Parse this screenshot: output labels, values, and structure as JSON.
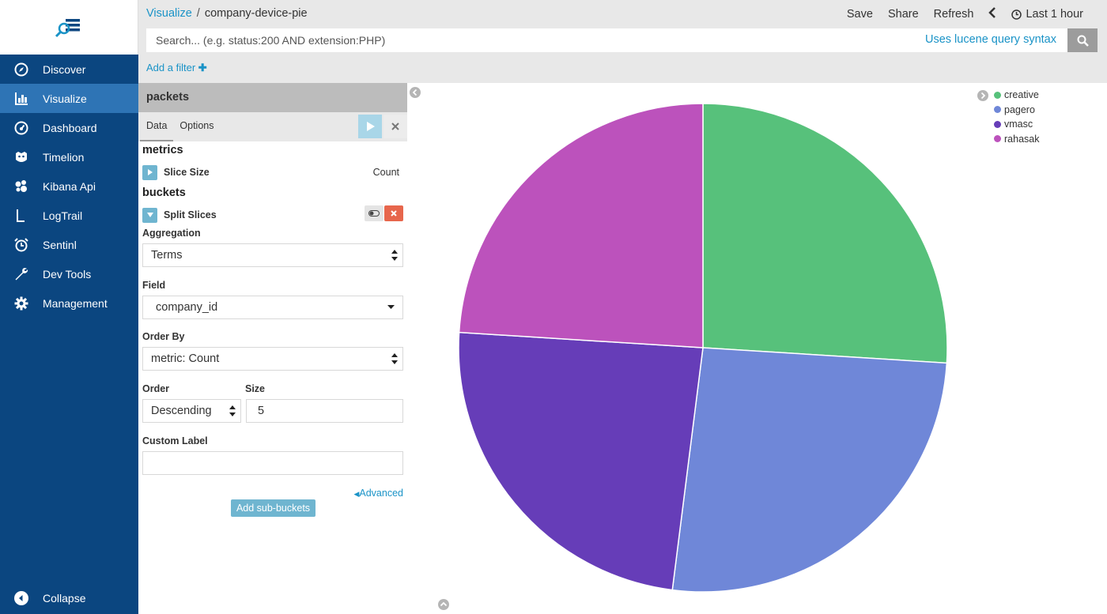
{
  "breadcrumb": {
    "root": "Visualize",
    "separator": "/",
    "current": "company-device-pie"
  },
  "top_menu": {
    "save": "Save",
    "share": "Share",
    "refresh": "Refresh",
    "time_range": "Last 1 hour"
  },
  "search": {
    "placeholder": "Search... (e.g. status:200 AND extension:PHP)",
    "syntax_link": "Uses lucene query syntax"
  },
  "add_filter": "Add a filter",
  "sidebar": {
    "items": [
      {
        "label": "Discover",
        "icon": "compass-icon",
        "active": false
      },
      {
        "label": "Visualize",
        "icon": "bar-chart-icon",
        "active": true
      },
      {
        "label": "Dashboard",
        "icon": "gauge-icon",
        "active": false
      },
      {
        "label": "Timelion",
        "icon": "timelion-icon",
        "active": false
      },
      {
        "label": "Kibana Api",
        "icon": "hexagons-icon",
        "active": false
      },
      {
        "label": "LogTrail",
        "icon": "logtrail-icon",
        "active": false
      },
      {
        "label": "Sentinl",
        "icon": "alarm-clock-icon",
        "active": false
      },
      {
        "label": "Dev Tools",
        "icon": "wrench-icon",
        "active": false
      },
      {
        "label": "Management",
        "icon": "gear-icon",
        "active": false
      }
    ],
    "collapse": "Collapse"
  },
  "editor": {
    "index_title": "packets",
    "tabs": [
      "Data",
      "Options"
    ],
    "metrics_heading": "metrics",
    "metric": {
      "title": "Slice Size",
      "value": "Count"
    },
    "buckets_heading": "buckets",
    "bucket": {
      "title": "Split Slices"
    },
    "aggregation": {
      "label": "Aggregation",
      "value": "Terms"
    },
    "field": {
      "label": "Field",
      "value": "company_id"
    },
    "order_by": {
      "label": "Order By",
      "value": "metric: Count"
    },
    "order": {
      "label": "Order",
      "value": "Descending"
    },
    "size": {
      "label": "Size",
      "value": "5"
    },
    "custom_label": {
      "label": "Custom Label",
      "value": ""
    },
    "advanced": "Advanced",
    "add_sub_buckets": "Add sub-buckets"
  },
  "chart_data": {
    "type": "pie",
    "categories": [
      "creative",
      "pagero",
      "vmasc",
      "rahasak"
    ],
    "values": [
      26,
      26,
      24,
      24
    ],
    "colors": [
      "#57c17b",
      "#6f87d8",
      "#663db8",
      "#bc52bc"
    ],
    "legend_position": "top-right"
  }
}
